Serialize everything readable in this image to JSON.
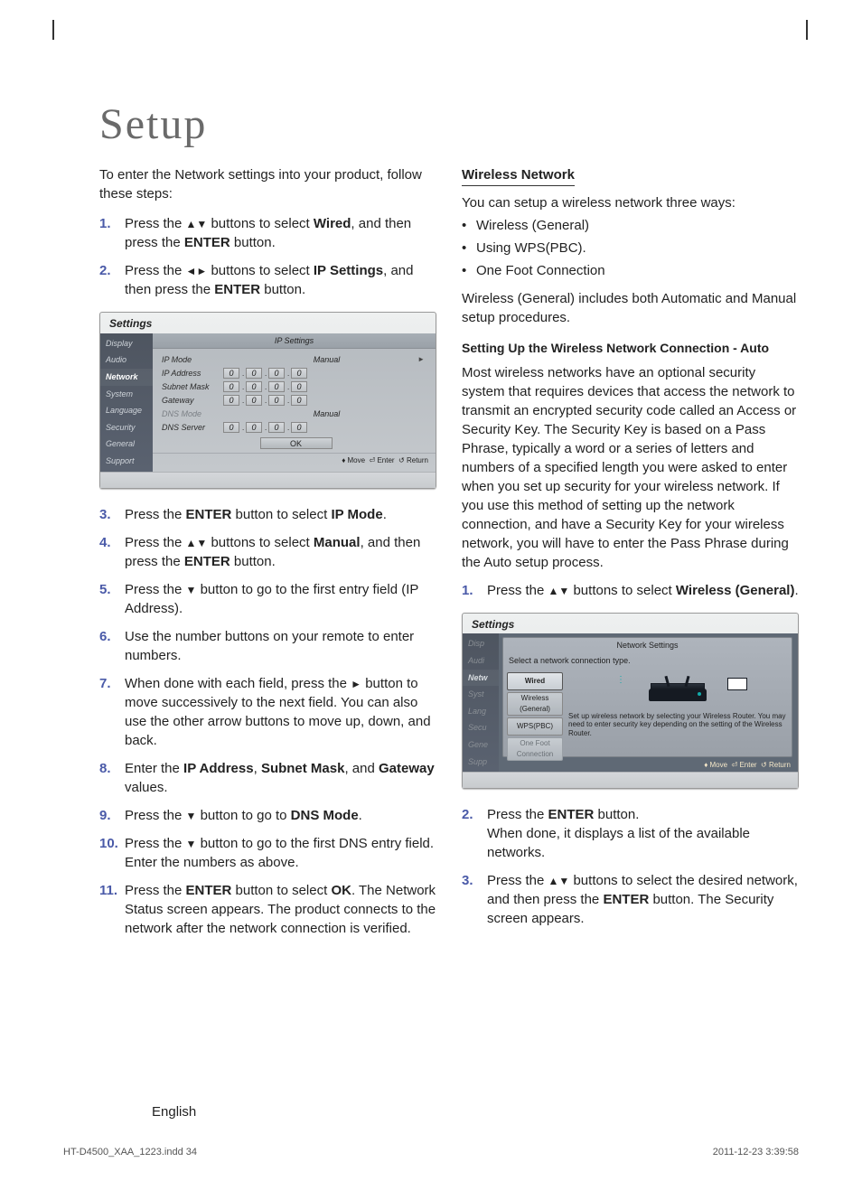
{
  "title": "Setup",
  "left": {
    "intro": "To enter the Network settings into your product, follow these steps:",
    "step1_a": "Press the ",
    "step1_b": " buttons to select ",
    "step1_wired": "Wired",
    "step1_c": ", and then press the ",
    "step1_enter": "ENTER",
    "step1_d": " button.",
    "step2_a": "Press the ",
    "step2_b": " buttons to select ",
    "step2_ip": "IP Settings",
    "step2_c": ", and then press the ",
    "step2_enter": "ENTER",
    "step2_d": " button.",
    "step3_a": "Press the ",
    "step3_enter": "ENTER",
    "step3_b": " button to select ",
    "step3_ip": "IP Mode",
    "step3_c": ".",
    "step4_a": "Press the ",
    "step4_b": " buttons to select ",
    "step4_manual": "Manual",
    "step4_c": ", and then press the ",
    "step4_enter": "ENTER",
    "step4_d": " button.",
    "step5_a": "Press the ",
    "step5_b": " button to go to the first entry field (IP Address).",
    "step6": "Use the number buttons on your remote to enter numbers.",
    "step7_a": "When done with each field, press the ",
    "step7_b": " button to move successively to the next field. You can also use the other arrow buttons to move up, down, and back.",
    "step8_a": "Enter the ",
    "step8_ip": "IP Address",
    "step8_c1": ", ",
    "step8_sm": "Subnet Mask",
    "step8_c2": ", and ",
    "step8_gw": "Gateway",
    "step8_c3": " values.",
    "step9_a": "Press the ",
    "step9_b": " button to go to ",
    "step9_dns": "DNS Mode",
    "step9_c": ".",
    "step10_a": "Press the ",
    "step10_b": " button to go to the first DNS entry field. Enter the numbers as above.",
    "step11_a": "Press the ",
    "step11_enter": "ENTER",
    "step11_b": " button to select ",
    "step11_ok": "OK",
    "step11_c": ". The Network Status screen appears. The product connects to the network after the network connection is verified.",
    "nums": {
      "n1": "1.",
      "n2": "2.",
      "n3": "3.",
      "n4": "4.",
      "n5": "5.",
      "n6": "6.",
      "n7": "7.",
      "n8": "8.",
      "n9": "9.",
      "n10": "10.",
      "n11": "11."
    }
  },
  "ui1": {
    "header": "Settings",
    "side": [
      "Display",
      "Audio",
      "Network",
      "System",
      "Language",
      "Security",
      "General",
      "Support"
    ],
    "side_hl_index": 2,
    "tab": "IP Settings",
    "rows": {
      "ipmode_label": "IP Mode",
      "ipmode_value": "Manual",
      "ipaddr_label": "IP Address",
      "subnet_label": "Subnet Mask",
      "gateway_label": "Gateway",
      "dnsmode_label": "DNS Mode",
      "dnsmode_value": "Manual",
      "dnsserver_label": "DNS Server"
    },
    "ipvals": [
      "0",
      "0",
      "0",
      "0"
    ],
    "ok": "OK",
    "legend": {
      "move": "Move",
      "enter": "Enter",
      "return": "Return"
    }
  },
  "right": {
    "h_wireless": "Wireless Network",
    "intro": "You can setup a wireless network three ways:",
    "bul1": "Wireless (General)",
    "bul2": "Using WPS(PBC).",
    "bul3": "One Foot Connection",
    "p_manual": "Wireless (General) includes both Automatic and Manual setup procedures.",
    "h_setup": "Setting Up the Wireless Network Connection - Auto",
    "p_long": "Most wireless networks have an optional security system that requires devices that access the network to transmit an encrypted security code called an Access or Security Key. The Security Key is based on a Pass Phrase, typically a word or a series of letters and numbers of a specified length you were asked to enter when you set up security for your wireless network. If you use this method of setting up the network connection, and have a Security Key for your wireless network, you will have to enter the Pass Phrase during the Auto setup process.",
    "s1_a": "Press the ",
    "s1_b": " buttons to select ",
    "s1_w": "Wireless (General)",
    "s1_c": ".",
    "s2_a": "Press the ",
    "s2_enter": "ENTER",
    "s2_b": " button.",
    "s2_c": "When done, it displays a list of the available networks.",
    "s3_a": "Press the ",
    "s3_b": " buttons to select the desired network, and then press the ",
    "s3_enter": "ENTER",
    "s3_c": " button. The Security screen appears.",
    "nums": {
      "n1": "1.",
      "n2": "2.",
      "n3": "3."
    }
  },
  "ui2": {
    "header": "Settings",
    "side": [
      "Display",
      "Audio",
      "Network",
      "System",
      "Language",
      "Security",
      "General",
      "Support"
    ],
    "modal_title": "Network Settings",
    "hint": "Select a network connection type.",
    "tabs": {
      "wired": "Wired",
      "wireless": "Wireless\n(General)",
      "wps": "WPS(PBC)",
      "onefoot": "One Foot\nConnection"
    },
    "desc": "Set up wireless network by selecting your Wireless Router. You may need to enter security key depending on the setting of the Wireless Router.",
    "legend": {
      "move": "Move",
      "enter": "Enter",
      "return": "Return"
    }
  },
  "glyphs": {
    "updown": "▲▼",
    "leftright": "◄►",
    "down": "▼",
    "right": "►",
    "ud_legend": "♦",
    "enter_icon": "⏎",
    "return_icon": "↺"
  },
  "footer": {
    "lang": "English",
    "file": "HT-D4500_XAA_1223.indd   34",
    "date": "2011-12-23   3:39:58"
  }
}
